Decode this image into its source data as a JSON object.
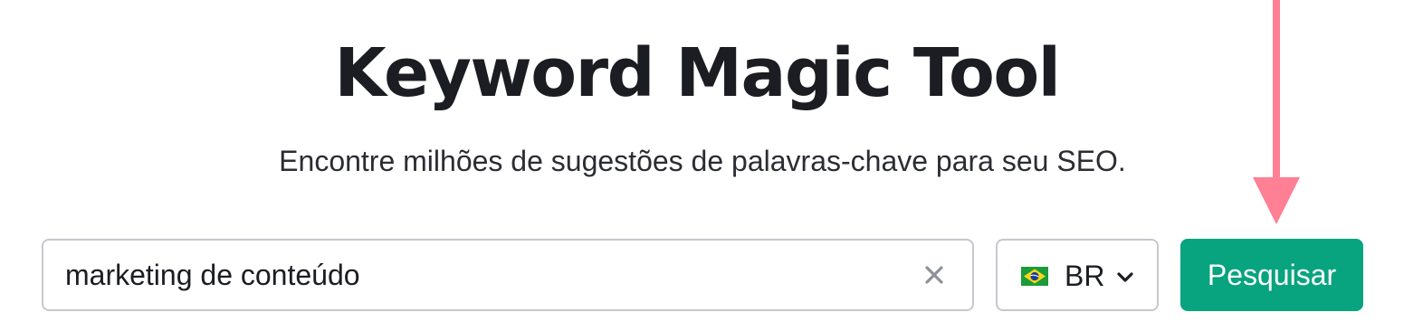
{
  "header": {
    "title": "Keyword Magic Tool",
    "subtitle": "Encontre milhões de sugestões de palavras-chave para seu SEO."
  },
  "search": {
    "value": "marketing de conteúdo",
    "clear_icon": "close-icon"
  },
  "country": {
    "code": "BR",
    "flag_icon": "brazil-flag-icon",
    "dropdown_icon": "chevron-down-icon"
  },
  "actions": {
    "search_label": "Pesquisar"
  },
  "colors": {
    "accent": "#08a37f",
    "annotation_arrow": "#ff7f94",
    "border": "#c6c8ce",
    "text": "#1b1d22"
  }
}
